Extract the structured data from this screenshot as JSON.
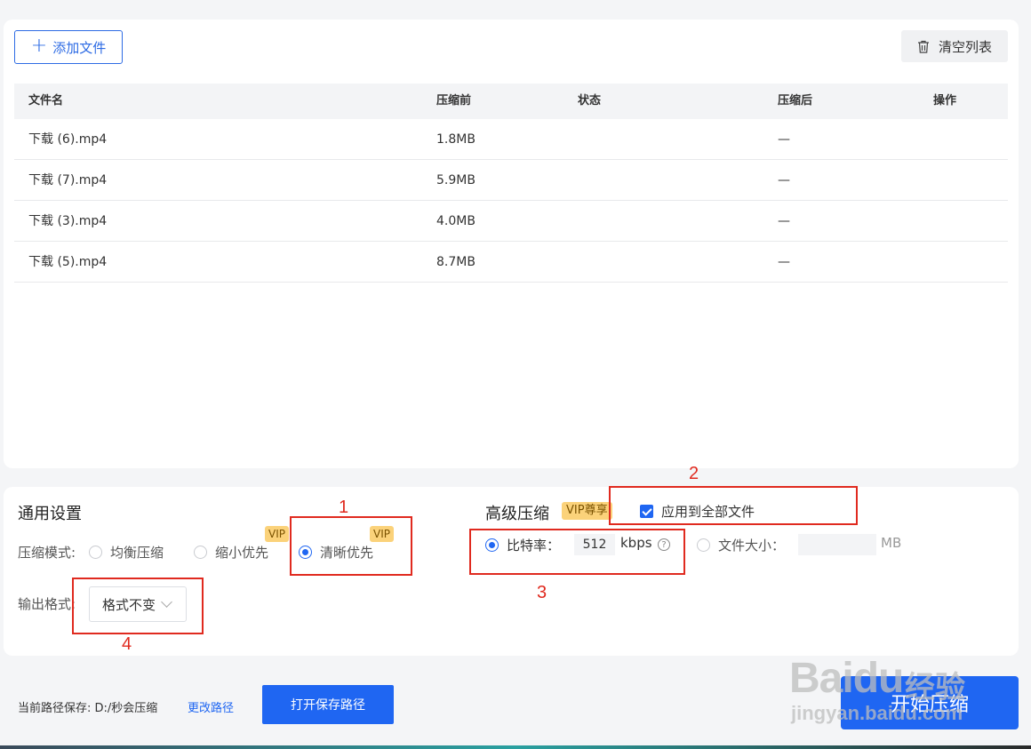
{
  "toolbar": {
    "add_file_label": "添加文件",
    "clear_list_label": "清空列表"
  },
  "table": {
    "headers": {
      "name": "文件名",
      "before": "压缩前",
      "status": "状态",
      "after": "压缩后",
      "operation": "操作"
    },
    "rows": [
      {
        "name": "下载 (6).mp4",
        "before": "1.8MB",
        "status": "",
        "after": "—"
      },
      {
        "name": "下载 (7).mp4",
        "before": "5.9MB",
        "status": "",
        "after": "—"
      },
      {
        "name": "下载 (3).mp4",
        "before": "4.0MB",
        "status": "",
        "after": "—"
      },
      {
        "name": "下载 (5).mp4",
        "before": "8.7MB",
        "status": "",
        "after": "—"
      }
    ]
  },
  "general": {
    "title": "通用设置",
    "mode_label": "压缩模式:",
    "modes": [
      {
        "label": "均衡压缩",
        "selected": false,
        "vip": false
      },
      {
        "label": "缩小优先",
        "selected": false,
        "vip": true
      },
      {
        "label": "清晰优先",
        "selected": true,
        "vip": true
      }
    ],
    "vip_tag": "VIP",
    "format_label": "输出格式:",
    "format_value": "格式不变"
  },
  "advanced": {
    "title": "高级压缩",
    "vip_tag": "VIP尊享",
    "apply_all_label": "应用到全部文件",
    "apply_all_checked": true,
    "bitrate_label": "比特率：",
    "bitrate_value": "512",
    "bitrate_unit": "kbps",
    "help_glyph": "?",
    "filesize_label": "文件大小：",
    "filesize_value": "",
    "filesize_unit": "MB"
  },
  "annotations": [
    "1",
    "2",
    "3",
    "4"
  ],
  "footer": {
    "path_label": "当前路径保存: D:/秒会压缩",
    "change_path_label": "更改路径",
    "open_path_label": "打开保存路径",
    "start_label": "开始压缩"
  },
  "watermark": {
    "main": "Baidu",
    "cn": "经验",
    "sub": "jingyan.baidu.com"
  },
  "colors": {
    "accent": "#1f66f2",
    "annotation": "#e02a1f",
    "vip": "#fbd27a"
  }
}
